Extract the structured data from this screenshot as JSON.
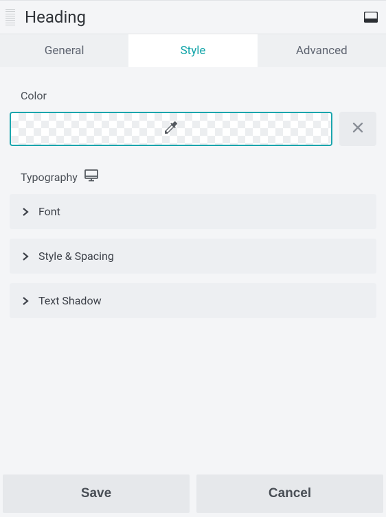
{
  "header": {
    "title": "Heading"
  },
  "tabs": {
    "general": "General",
    "style": "Style",
    "advanced": "Advanced",
    "active": "style"
  },
  "sections": {
    "color_label": "Color",
    "typography_label": "Typography"
  },
  "accordion": {
    "font": "Font",
    "style_spacing": "Style & Spacing",
    "text_shadow": "Text Shadow"
  },
  "footer": {
    "save": "Save",
    "cancel": "Cancel"
  },
  "colors": {
    "accent": "#1aa5ad",
    "panel_bg": "#f4f5f7"
  }
}
